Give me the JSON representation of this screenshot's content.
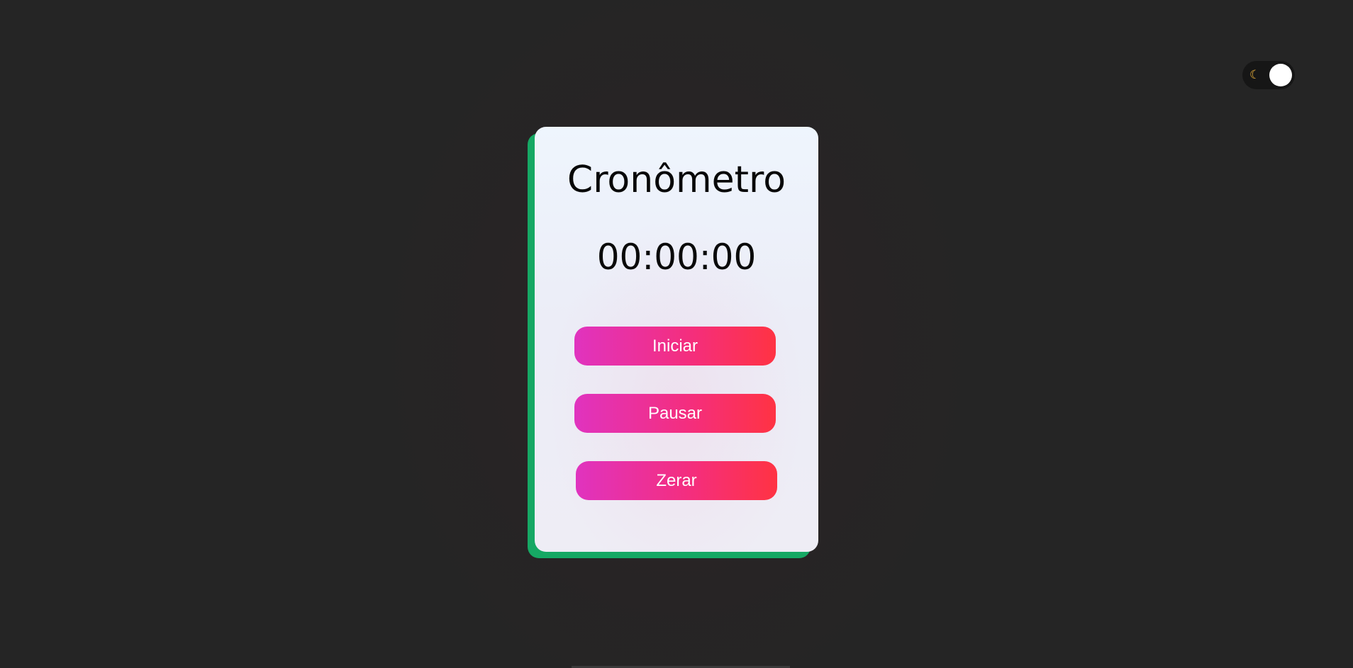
{
  "theme_toggle": {
    "icon": "moon-icon",
    "glyph": "☾",
    "state": "dark"
  },
  "stopwatch": {
    "title": "Cronômetro",
    "time": "00:00:00"
  },
  "buttons": {
    "start_label": "Iniciar",
    "pause_label": "Pausar",
    "reset_label": "Zerar"
  },
  "colors": {
    "background": "#252525",
    "card": "#eef1f9",
    "card_accent": "#16a864",
    "button_gradient_start": "#e033bf",
    "button_gradient_end": "#ff3343",
    "moon": "#f4b73b"
  }
}
